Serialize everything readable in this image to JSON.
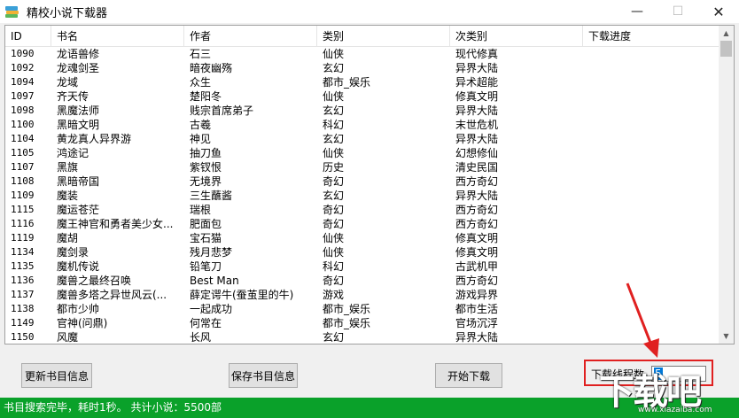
{
  "window": {
    "title": "精校小说下载器",
    "min_glyph": "—",
    "max_glyph": "☐",
    "close_glyph": "✕"
  },
  "table": {
    "columns": [
      "ID",
      "书名",
      "作者",
      "类别",
      "次类别",
      "下载进度"
    ],
    "rows": [
      [
        "1090",
        "龙语兽修",
        "石三",
        "仙侠",
        "现代修真",
        ""
      ],
      [
        "1092",
        "龙魂剑圣",
        "暗夜幽殇",
        "玄幻",
        "异界大陆",
        ""
      ],
      [
        "1094",
        "龙域",
        "众生",
        "都市_娱乐",
        "异术超能",
        ""
      ],
      [
        "1097",
        "齐天传",
        "楚阳冬",
        "仙侠",
        "修真文明",
        ""
      ],
      [
        "1098",
        "黑魔法师",
        "贱宗首席弟子",
        "玄幻",
        "异界大陆",
        ""
      ],
      [
        "1100",
        "黑暗文明",
        "古羲",
        "科幻",
        "末世危机",
        ""
      ],
      [
        "1104",
        "黄龙真人异界游",
        "神见",
        "玄幻",
        "异界大陆",
        ""
      ],
      [
        "1105",
        "鸿途记",
        "抽刀鱼",
        "仙侠",
        "幻想修仙",
        ""
      ],
      [
        "1107",
        "黑旗",
        "紫钗恨",
        "历史",
        "清史民国",
        ""
      ],
      [
        "1108",
        "黑暗帝国",
        "无境界",
        "奇幻",
        "西方奇幻",
        ""
      ],
      [
        "1109",
        "魔装",
        "三生蘸酱",
        "玄幻",
        "异界大陆",
        ""
      ],
      [
        "1115",
        "魔运苍茫",
        "瑞根",
        "奇幻",
        "西方奇幻",
        ""
      ],
      [
        "1116",
        "魔王神官和勇者美少女...",
        "肥面包",
        "奇幻",
        "西方奇幻",
        ""
      ],
      [
        "1119",
        "魔胡",
        "宝石猫",
        "仙侠",
        "修真文明",
        ""
      ],
      [
        "1134",
        "魔剑录",
        "残月悲梦",
        "仙侠",
        "修真文明",
        ""
      ],
      [
        "1135",
        "魔机传说",
        "铅笔刀",
        "科幻",
        "古武机甲",
        ""
      ],
      [
        "1136",
        "魔兽之最终召唤",
        "Best Man",
        "奇幻",
        "西方奇幻",
        ""
      ],
      [
        "1137",
        "魔兽多塔之异世风云(...",
        "薛定谔牛(蚕茧里的牛)",
        "游戏",
        "游戏异界",
        ""
      ],
      [
        "1138",
        "都市少帅",
        "一起成功",
        "都市_娱乐",
        "都市生活",
        ""
      ],
      [
        "1149",
        "官神(问鼎)",
        "何常在",
        "都市_娱乐",
        "官场沉浮",
        ""
      ],
      [
        "1150",
        "风魔",
        "长风",
        "玄幻",
        "异界大陆",
        ""
      ]
    ]
  },
  "scroll": {
    "up_glyph": "▲",
    "down_glyph": "▼"
  },
  "buttons": {
    "refresh": "更新书目信息",
    "save": "保存书目信息",
    "start": "开始下载"
  },
  "threads": {
    "label": "下载线程数",
    "value": "5"
  },
  "status": {
    "text": "书目搜索完毕，耗时1秒。  共计小说：5500部"
  },
  "watermark": {
    "logo": "下载吧",
    "url": "www.xiazaiba.com"
  },
  "colors": {
    "status_bar": "#0aa12a",
    "highlight_box": "#e02020",
    "arrow": "#e02020"
  }
}
